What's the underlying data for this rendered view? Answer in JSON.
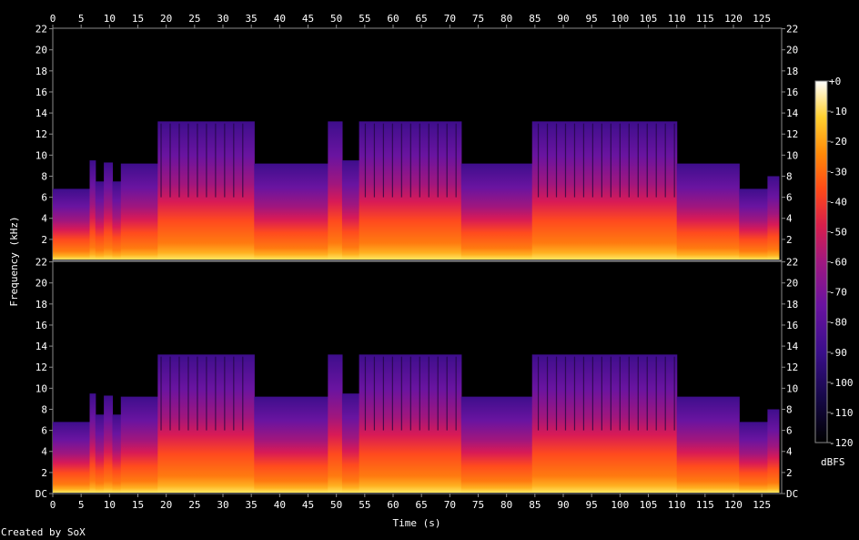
{
  "chart_data": {
    "type": "heatmap",
    "title": "",
    "xlabel": "Time (s)",
    "ylabel": "Frequency (kHz)",
    "colorbar_label": "dBFS",
    "x_range": [
      0,
      128.5
    ],
    "y_range": [
      0,
      22.05
    ],
    "x_ticks": [
      0,
      5,
      10,
      15,
      20,
      25,
      30,
      35,
      40,
      45,
      50,
      55,
      60,
      65,
      70,
      75,
      80,
      85,
      90,
      95,
      100,
      105,
      110,
      115,
      120,
      125
    ],
    "y_ticks_top": [
      "2",
      "4",
      "6",
      "8",
      "10",
      "12",
      "14",
      "16",
      "18",
      "20",
      "22"
    ],
    "y_ticks_bottom": [
      "DC",
      "2",
      "4",
      "6",
      "8",
      "10",
      "12",
      "14",
      "16",
      "18",
      "20",
      "22"
    ],
    "colorbar_ticks": [
      "+0",
      "-10",
      "-20",
      "-30",
      "-40",
      "-50",
      "-60",
      "-70",
      "-80",
      "-90",
      "-100",
      "-110",
      "-120"
    ],
    "colorbar_range_dbfs": [
      -120,
      0
    ],
    "channels": 2,
    "colormap": [
      "#000000",
      "#1a0a5a",
      "#5a13a0",
      "#a01a7c",
      "#e0204a",
      "#ff5a10",
      "#ffa500",
      "#ffe040",
      "#ffffff"
    ],
    "band_envelope_khz": [
      {
        "t": [
          0,
          6.5
        ],
        "f": 6.8
      },
      {
        "t": [
          6.5,
          7.5
        ],
        "f": 9.5
      },
      {
        "t": [
          7.5,
          9
        ],
        "f": 7.5
      },
      {
        "t": [
          9,
          10.5
        ],
        "f": 9.3
      },
      {
        "t": [
          10.5,
          12
        ],
        "f": 7.5
      },
      {
        "t": [
          12,
          18.5
        ],
        "f": 9.2
      },
      {
        "t": [
          18.5,
          35.5
        ],
        "f": 13.2
      },
      {
        "t": [
          35.5,
          48.5
        ],
        "f": 9.2
      },
      {
        "t": [
          48.5,
          51
        ],
        "f": 13.2
      },
      {
        "t": [
          51,
          54
        ],
        "f": 9.5
      },
      {
        "t": [
          54,
          72
        ],
        "f": 13.2
      },
      {
        "t": [
          72,
          84.5
        ],
        "f": 9.2
      },
      {
        "t": [
          84.5,
          110
        ],
        "f": 13.2
      },
      {
        "t": [
          110,
          121
        ],
        "f": 9.2
      },
      {
        "t": [
          121,
          126
        ],
        "f": 6.8
      },
      {
        "t": [
          126,
          128
        ],
        "f": 8
      }
    ],
    "credit": "Created by SoX"
  }
}
